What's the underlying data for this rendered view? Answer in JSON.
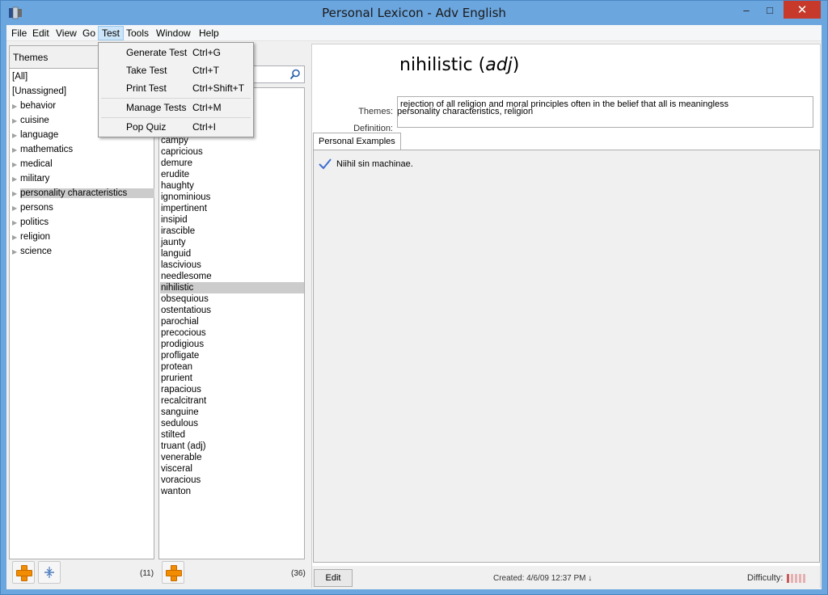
{
  "window": {
    "title": "Personal Lexicon - Adv English",
    "min_label": "–",
    "max_label": "□",
    "close_label": "✕"
  },
  "menubar": [
    {
      "label": "File"
    },
    {
      "label": "Edit"
    },
    {
      "label": "View"
    },
    {
      "label": "Go"
    },
    {
      "label": "Test"
    },
    {
      "label": "Tools"
    },
    {
      "label": "Window"
    },
    {
      "label": "Help"
    }
  ],
  "test_menu": [
    {
      "label": "Generate Test",
      "shortcut": "Ctrl+G"
    },
    {
      "label": "Take Test",
      "shortcut": "Ctrl+T"
    },
    {
      "label": "Print Test",
      "shortcut": "Ctrl+Shift+T"
    },
    {
      "label": "Manage Tests",
      "shortcut": "Ctrl+M"
    },
    {
      "label": "Pop Quiz",
      "shortcut": "Ctrl+I"
    }
  ],
  "themes": {
    "header": "Themes",
    "items": [
      {
        "label": "[All]",
        "expandable": false
      },
      {
        "label": "[Unassigned]",
        "expandable": false
      },
      {
        "label": "behavior",
        "expandable": true
      },
      {
        "label": "cuisine",
        "expandable": true
      },
      {
        "label": "language",
        "expandable": true
      },
      {
        "label": "mathematics",
        "expandable": true
      },
      {
        "label": "medical",
        "expandable": true
      },
      {
        "label": "military",
        "expandable": true
      },
      {
        "label": "personality characteristics",
        "expandable": true,
        "selected": true
      },
      {
        "label": "persons",
        "expandable": true
      },
      {
        "label": "politics",
        "expandable": true
      },
      {
        "label": "religion",
        "expandable": true
      },
      {
        "label": "science",
        "expandable": true
      }
    ],
    "count": "(11)"
  },
  "words": {
    "tab_stub": "s",
    "items": [
      "campy",
      "capricious",
      "demure",
      "erudite",
      "haughty",
      "ignominious",
      "impertinent",
      "insipid",
      "irascible",
      "jaunty",
      "languid",
      "lascivious",
      "needlesome",
      "nihilistic",
      "obsequious",
      "ostentatious",
      "parochial",
      "precocious",
      "prodigious",
      "profligate",
      "protean",
      "prurient",
      "rapacious",
      "recalcitrant",
      "sanguine",
      "sedulous",
      "stilted",
      "truant (adj)",
      "venerable",
      "visceral",
      "voracious",
      "wanton"
    ],
    "selected": "nihilistic",
    "count": "(36)"
  },
  "detail": {
    "word": "nihilistic",
    "pos": "adj",
    "themes_label": "Themes:",
    "themes_value": "personality characteristics, religion",
    "definition_label": "Definition:",
    "definition": "rejection of all religion and moral principles often in the belief that all is meaningless",
    "tab_label": "Personal Examples",
    "examples": [
      "Niihil sin machinae."
    ],
    "edit_label": "Edit",
    "created": "Created:  4/6/09 12:37 PM ↓",
    "difficulty_label": "Difficulty:",
    "difficulty_level": 1,
    "difficulty_max": 5
  }
}
